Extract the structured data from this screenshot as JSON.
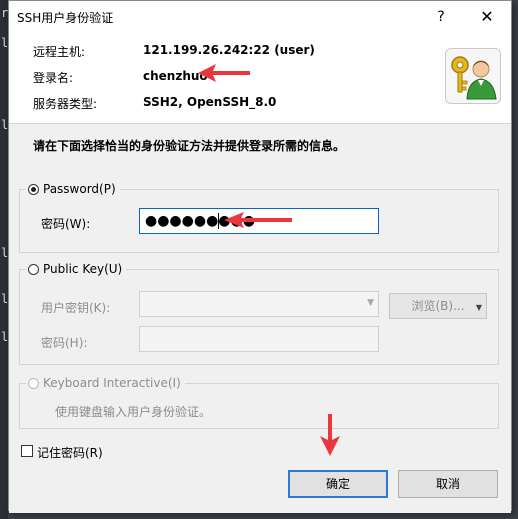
{
  "dialog": {
    "title": "SSH用户身份验证",
    "help_symbol": "?",
    "close_symbol": "✕"
  },
  "info": {
    "remote_host_label": "远程主机:",
    "remote_host_value": "121.199.26.242:22 (user)",
    "login_label": "登录名:",
    "login_value": "chenzhuo",
    "server_type_label": "服务器类型:",
    "server_type_value": "SSH2, OpenSSH_8.0"
  },
  "instruction": "请在下面选择恰当的身份验证方法并提供登录所需的信息。",
  "password_method": {
    "label": "Password(P)",
    "selected": true,
    "password_label": "密码(W):",
    "password_masked": "●●●●●●●●●"
  },
  "publickey_method": {
    "label": "Public Key(U)",
    "selected": false,
    "user_key_label": "用户密钥(K):",
    "browse_label": "浏览(B)...",
    "passphrase_label": "密码(H):"
  },
  "keyboard_method": {
    "label": "Keyboard Interactive(I)",
    "selected": false,
    "description": "使用键盘输入用户身份验证。"
  },
  "remember_password": {
    "label": "记住密码(R)",
    "checked": false
  },
  "buttons": {
    "ok": "确定",
    "cancel": "取消"
  },
  "colors": {
    "annotation_arrow": "#e8383d",
    "focus_border": "#0a64c8"
  },
  "icons": {
    "app_icon": "key-user-icon"
  }
}
